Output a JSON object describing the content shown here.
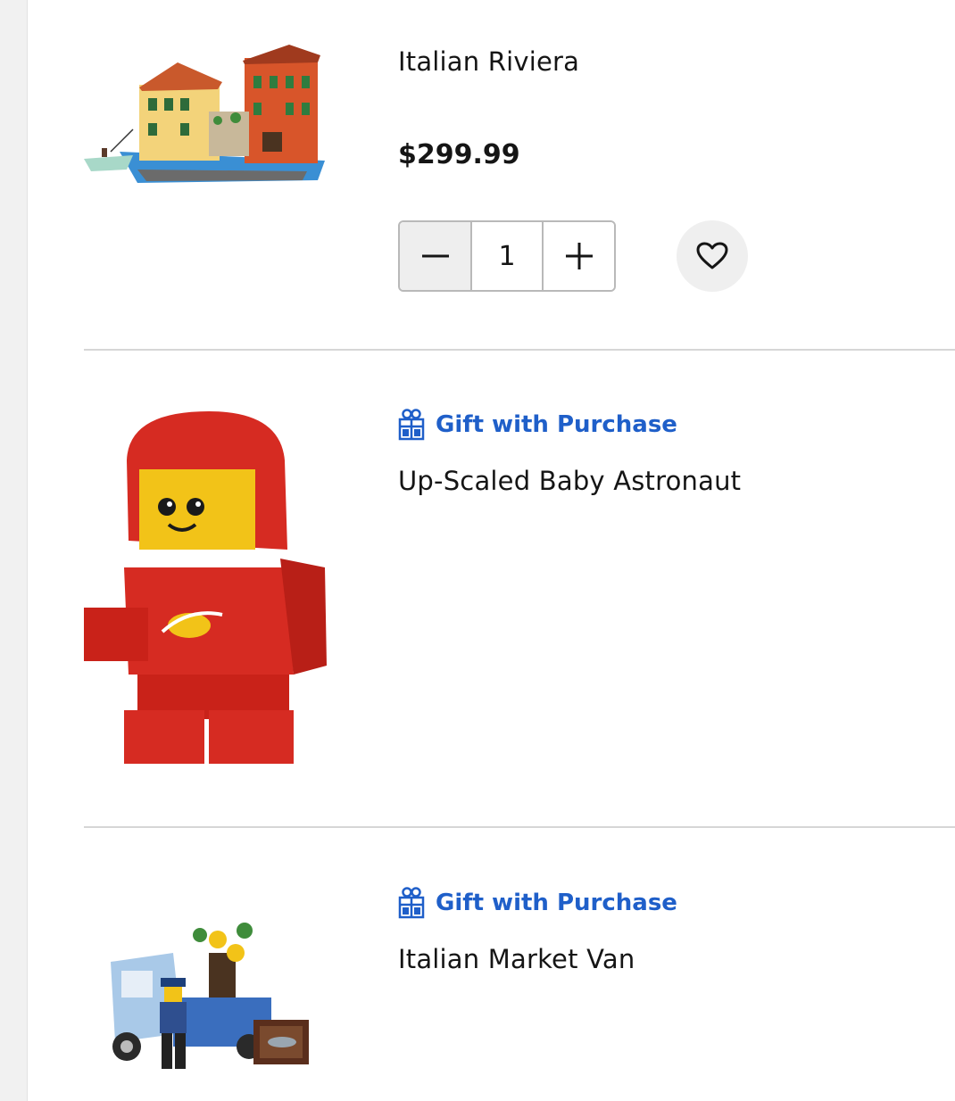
{
  "items": [
    {
      "title": "Italian Riviera",
      "price": "$299.99",
      "quantity": "1",
      "image_icon": "italian-riviera-set-image"
    },
    {
      "badge": "Gift with Purchase",
      "title": "Up-Scaled Baby Astronaut",
      "image_icon": "baby-astronaut-image"
    },
    {
      "badge": "Gift with Purchase",
      "title": "Italian Market Van",
      "image_icon": "market-van-image"
    }
  ],
  "colors": {
    "gift_blue": "#1f5fc9",
    "divider": "#d6d6d6",
    "astronaut_red": "#d62b22"
  }
}
